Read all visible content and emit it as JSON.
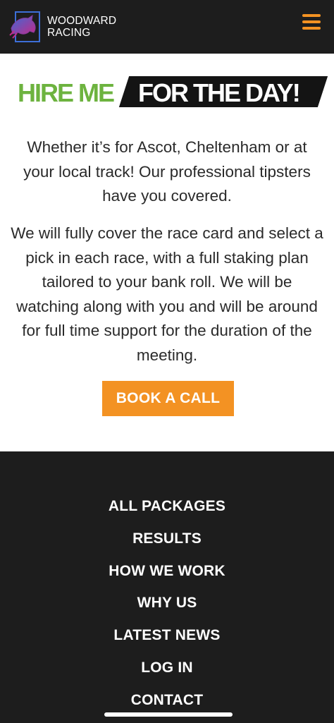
{
  "header": {
    "brand_line1": "WOODWARD",
    "brand_line2": "RACING",
    "logo_icon": "horse-head-logo-icon",
    "menu_icon": "hamburger-menu-icon"
  },
  "hero": {
    "headline_green": "HIRE ME",
    "headline_black": "FOR THE DAY!",
    "intro_lines": [
      "Whether it’s for Ascot, Cheltenham or at",
      "your local track! Our professional tipsters",
      "have you covered."
    ],
    "detail_lines": [
      "We will fully cover the race card and select a",
      "pick in each race, with a full staking plan",
      "tailored to your bank roll. We will be",
      "watching along with you and will be around",
      "for full time support for the duration of the",
      "meeting."
    ],
    "cta_label": "BOOK A CALL"
  },
  "footer": {
    "links": [
      "ALL PACKAGES",
      "RESULTS",
      "HOW WE WORK",
      "WHY US",
      "LATEST NEWS",
      "LOG IN",
      "CONTACT"
    ]
  },
  "colors": {
    "accent_orange": "#f39223",
    "headline_green": "#6db33f",
    "dark_background": "#1d1d1d"
  }
}
